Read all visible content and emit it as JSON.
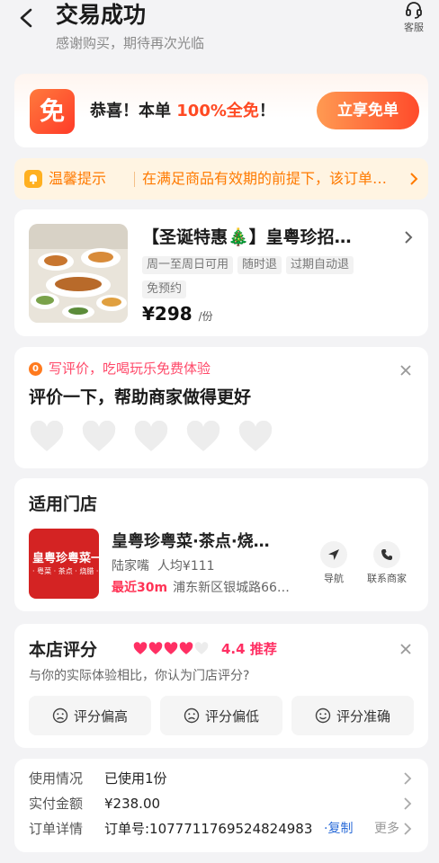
{
  "header": {
    "title": "交易成功",
    "subtitle": "感谢购买，期待再次光临",
    "service_label": "客服"
  },
  "promo": {
    "icon_char": "免",
    "text_prefix": "恭喜！本单 ",
    "text_highlight": "100%全免",
    "text_suffix": "！",
    "button_label": "立享免单"
  },
  "notice": {
    "title": "温馨提示",
    "text": "在满足商品有效期的前提下，该订单…"
  },
  "product": {
    "title": "【圣诞特惠🎄】皇粤珍招…",
    "tags": [
      "周一至周日可用",
      "随时退",
      "过期自动退",
      "免预约"
    ],
    "price": "¥298",
    "price_unit": "/份"
  },
  "review": {
    "badge": "0",
    "hint": "写评价，吃喝玩乐免费体验",
    "title": "评价一下，帮助商家做得更好",
    "heart_count": 5
  },
  "store": {
    "section_title": "适用门店",
    "logo_line1": "皇粤珍粤菜一",
    "logo_line2": "· 粤菜 · 茶点 · 烧腊 ·",
    "name": "皇粤珍粤菜·茶点·烧…",
    "area": "陆家嘴",
    "avg_price": "人均¥111",
    "distance": "最近30m",
    "address": "浦东新区银城路66…",
    "nav_label": "导航",
    "contact_label": "联系商家"
  },
  "rating": {
    "title": "本店评分",
    "score": "4.4",
    "score_tag": "推荐",
    "filled_hearts": 4,
    "total_hearts": 5,
    "question": "与你的实际体验相比，你认为门店评分?",
    "options": [
      "评分偏高",
      "评分偏低",
      "评分准确"
    ]
  },
  "order_info": {
    "usage_label": "使用情况",
    "usage_value": "已使用1份",
    "paid_label": "实付金额",
    "paid_value": "¥238.00",
    "detail_label": "订单详情",
    "detail_value": "订单号:1077711769524824983",
    "copy_label": "·复制",
    "more_label": "更多"
  },
  "colors": {
    "accent_orange": "#ff4a23",
    "notice_text": "#ff7a00",
    "heart_red": "#ff2f63",
    "link_blue": "#2a6bd8"
  }
}
